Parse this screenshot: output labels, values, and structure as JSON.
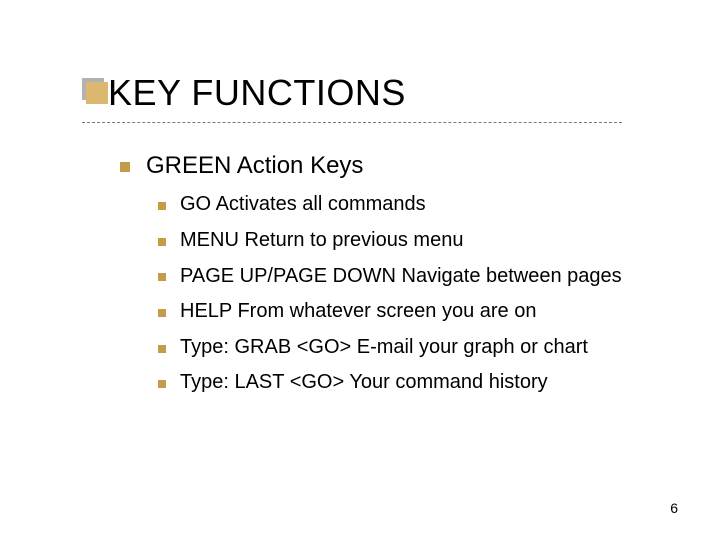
{
  "title": "KEY FUNCTIONS",
  "sub_heading": "GREEN Action Keys",
  "items": [
    "GO  Activates all commands",
    "MENU  Return to previous menu",
    "PAGE UP/PAGE DOWN  Navigate between pages",
    "HELP From whatever screen you are on",
    "Type: GRAB <GO> E-mail your graph or chart",
    "Type: LAST <GO>  Your command history"
  ],
  "page_number": "6"
}
